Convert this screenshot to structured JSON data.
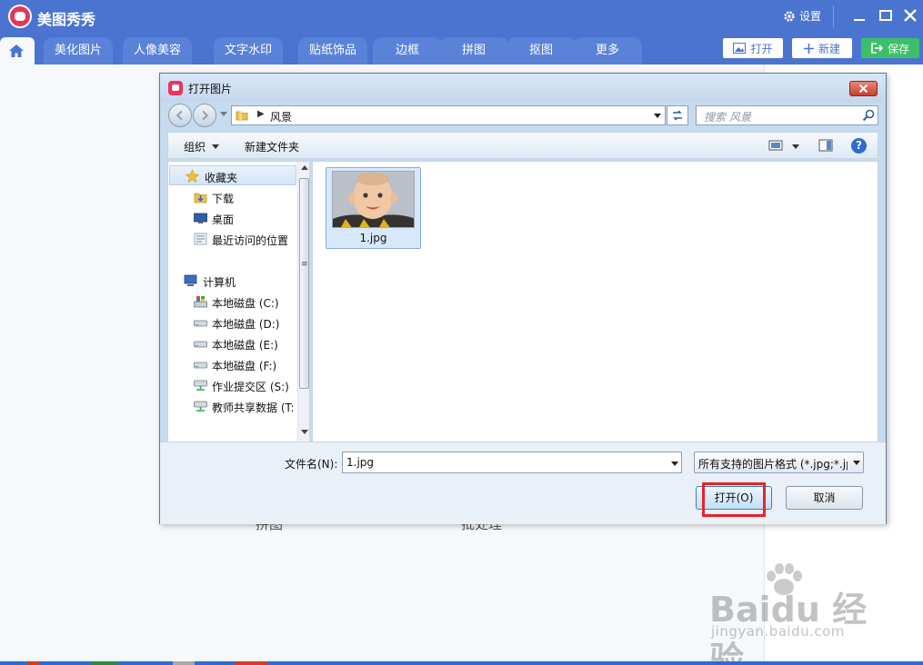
{
  "app": {
    "name": "美图秀秀",
    "settings_label": "设置"
  },
  "tabs": [
    "美化图片",
    "人像美容",
    "文字水印",
    "贴纸饰品",
    "边框",
    "拼图",
    "抠图",
    "更多"
  ],
  "toolbar": {
    "open_label": "打开",
    "new_label": "新建",
    "save_label": "保存"
  },
  "background": {
    "labels": [
      "拼图",
      "批处理"
    ]
  },
  "watermark": {
    "logo": "Baidu 经验",
    "sub": "jingyan.baidu.com"
  },
  "dialog": {
    "title": "打开图片",
    "address": "风景",
    "search_placeholder": "搜索 风景",
    "commands": {
      "organize": "组织",
      "new_folder": "新建文件夹"
    },
    "nav_items": [
      {
        "label": "收藏夹",
        "icon": "star-icon"
      },
      {
        "label": "下载",
        "icon": "download-folder-icon"
      },
      {
        "label": "桌面",
        "icon": "desktop-icon"
      },
      {
        "label": "最近访问的位置",
        "icon": "recent-places-icon"
      },
      {
        "label": "计算机",
        "icon": "computer-icon"
      },
      {
        "label": "本地磁盘 (C:)",
        "icon": "system-drive-icon"
      },
      {
        "label": "本地磁盘 (D:)",
        "icon": "drive-icon"
      },
      {
        "label": "本地磁盘 (E:)",
        "icon": "drive-icon"
      },
      {
        "label": "本地磁盘 (F:)",
        "icon": "drive-icon"
      },
      {
        "label": "作业提交区 (S:)",
        "icon": "network-drive-icon"
      },
      {
        "label": "教师共享数据 (T:",
        "icon": "network-drive-icon"
      }
    ],
    "files": [
      {
        "name": "1.jpg"
      }
    ],
    "filename_label": "文件名(N):",
    "filename_value": "1.jpg",
    "filetype_value": "所有支持的图片格式 (*.jpg;*.jp",
    "open_button": "打开(O)",
    "cancel_button": "取消"
  },
  "colors": {
    "title_bar": "#4a74d0",
    "save_green": "#3bbf6b",
    "logo_pink": "#e8345c",
    "highlight_red": "#e8232a"
  }
}
